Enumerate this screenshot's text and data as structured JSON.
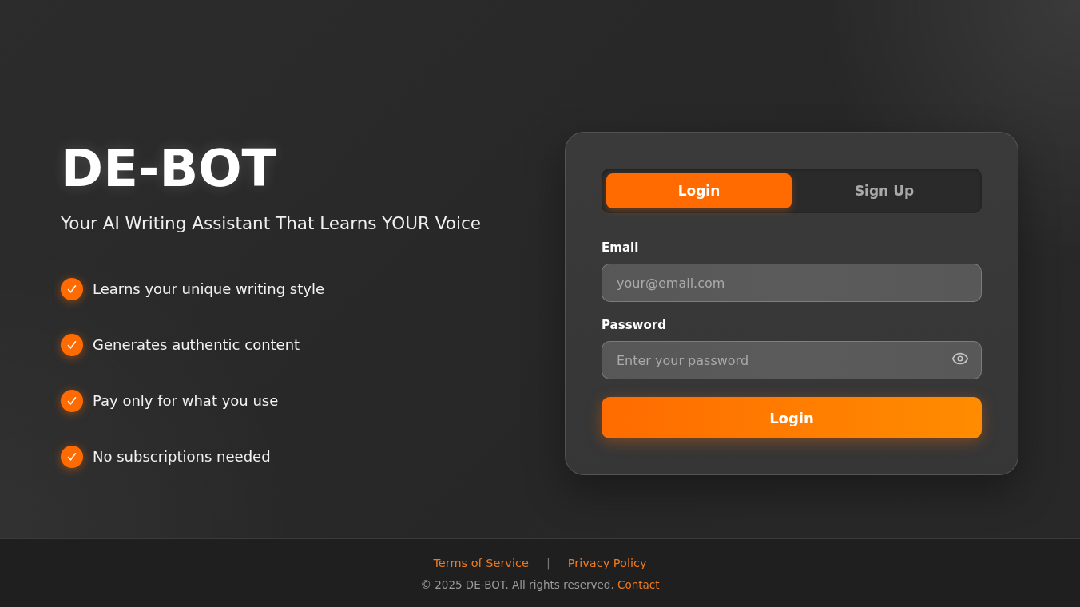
{
  "brand": {
    "title": "DE-BOT",
    "tagline": "Your AI Writing Assistant That Learns YOUR Voice"
  },
  "features": [
    "Learns your unique writing style",
    "Generates authentic content",
    "Pay only for what you use",
    "No subscriptions needed"
  ],
  "auth_card": {
    "tabs": [
      {
        "label": "Login",
        "selected": true
      },
      {
        "label": "Sign Up",
        "selected": false
      }
    ],
    "fields": [
      {
        "kind": "email",
        "label": "Email",
        "placeholder": "your@email.com"
      },
      {
        "kind": "password",
        "label": "Password",
        "placeholder": "Enter your password"
      }
    ],
    "submit_button": "Login"
  },
  "footer": {
    "links": [
      "Terms of Service",
      "Privacy Policy"
    ],
    "separator": "|",
    "copyright": "© 2025 DE-BOT. All rights reserved.",
    "contact_link": "Contact"
  }
}
